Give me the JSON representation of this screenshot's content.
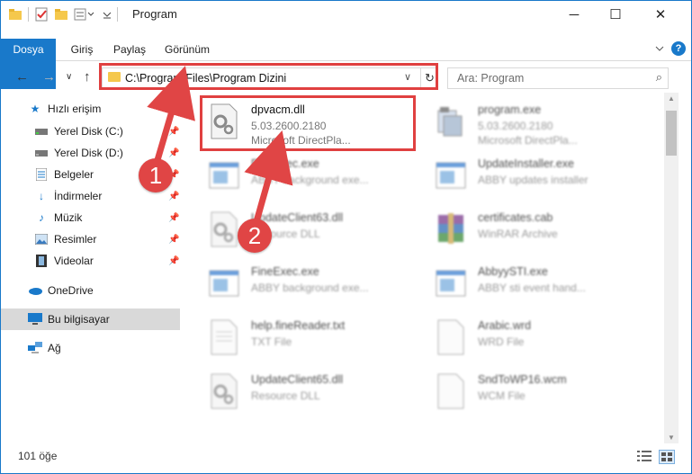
{
  "window": {
    "title": "Program",
    "controls": {
      "minimize": "─",
      "maximize": "☐",
      "close": "✕"
    }
  },
  "ribbon": {
    "tabs": [
      "Dosya",
      "Giriş",
      "Paylaş",
      "Görünüm"
    ],
    "help": "?"
  },
  "nav": {
    "back": "←",
    "forward": "→",
    "up": "↑",
    "address_path": "C:\\Program Files\\Program Dizini",
    "dropdown": "∨",
    "refresh": "↻",
    "search_placeholder": "Ara: Program",
    "search_icon": "⌕"
  },
  "sidebar": {
    "items": [
      {
        "label": "Hızlı erişim",
        "icon": "star-icon",
        "pinned": false
      },
      {
        "label": "Yerel Disk (C:)",
        "icon": "drive-icon",
        "pinned": true
      },
      {
        "label": "Yerel Disk (D:)",
        "icon": "drive-icon",
        "pinned": true
      },
      {
        "label": "Belgeler",
        "icon": "documents-icon",
        "pinned": true
      },
      {
        "label": "İndirmeler",
        "icon": "download-icon",
        "pinned": true
      },
      {
        "label": "Müzik",
        "icon": "music-icon",
        "pinned": true
      },
      {
        "label": "Resimler",
        "icon": "pictures-icon",
        "pinned": true
      },
      {
        "label": "Videolar",
        "icon": "video-icon",
        "pinned": true
      },
      {
        "label": "OneDrive",
        "icon": "cloud-icon",
        "pinned": false
      },
      {
        "label": "Bu bilgisayar",
        "icon": "computer-icon",
        "pinned": false,
        "selected": true
      },
      {
        "label": "Ağ",
        "icon": "network-icon",
        "pinned": false
      }
    ]
  },
  "files": [
    {
      "name": "dpvacm.dll",
      "line2": "5.03.2600.2180",
      "line3": "Microsoft DirectPla...",
      "icon": "dll-gear-icon",
      "highlighted": true
    },
    {
      "name": "program.exe",
      "line2": "5.03.2600.2180",
      "line3": "Microsoft DirectPla...",
      "icon": "exe-icon"
    },
    {
      "name": "FineExec.exe",
      "line2": "ABBY background exe...",
      "line3": "",
      "icon": "app-window-icon"
    },
    {
      "name": "UpdateInstaller.exe",
      "line2": "ABBY updates installer",
      "line3": "",
      "icon": "app-window-icon"
    },
    {
      "name": "UpdateClient63.dll",
      "line2": "Resource DLL",
      "line3": "",
      "icon": "dll-gear-icon"
    },
    {
      "name": "certificates.cab",
      "line2": "WinRAR Archive",
      "line3": "",
      "icon": "winrar-icon"
    },
    {
      "name": "FineExec.exe",
      "line2": "ABBY background exe...",
      "line3": "",
      "icon": "app-window-icon"
    },
    {
      "name": "AbbyySTI.exe",
      "line2": "ABBY sti event hand...",
      "line3": "",
      "icon": "app-window-icon"
    },
    {
      "name": "help.fineReader.txt",
      "line2": "TXT File",
      "line3": "",
      "icon": "text-file-icon"
    },
    {
      "name": "Arabic.wrd",
      "line2": "WRD File",
      "line3": "",
      "icon": "blank-file-icon"
    },
    {
      "name": "UpdateClient65.dll",
      "line2": "Resource DLL",
      "line3": "",
      "icon": "dll-gear-icon"
    },
    {
      "name": "SndToWP16.wcm",
      "line2": "WCM File",
      "line3": "",
      "icon": "blank-file-icon"
    }
  ],
  "status": {
    "item_count": "101 öğe"
  },
  "callouts": {
    "one": "1",
    "two": "2"
  },
  "colors": {
    "accent": "#1979ca",
    "highlight_red": "#e04040",
    "folder": "#f5c84c"
  }
}
